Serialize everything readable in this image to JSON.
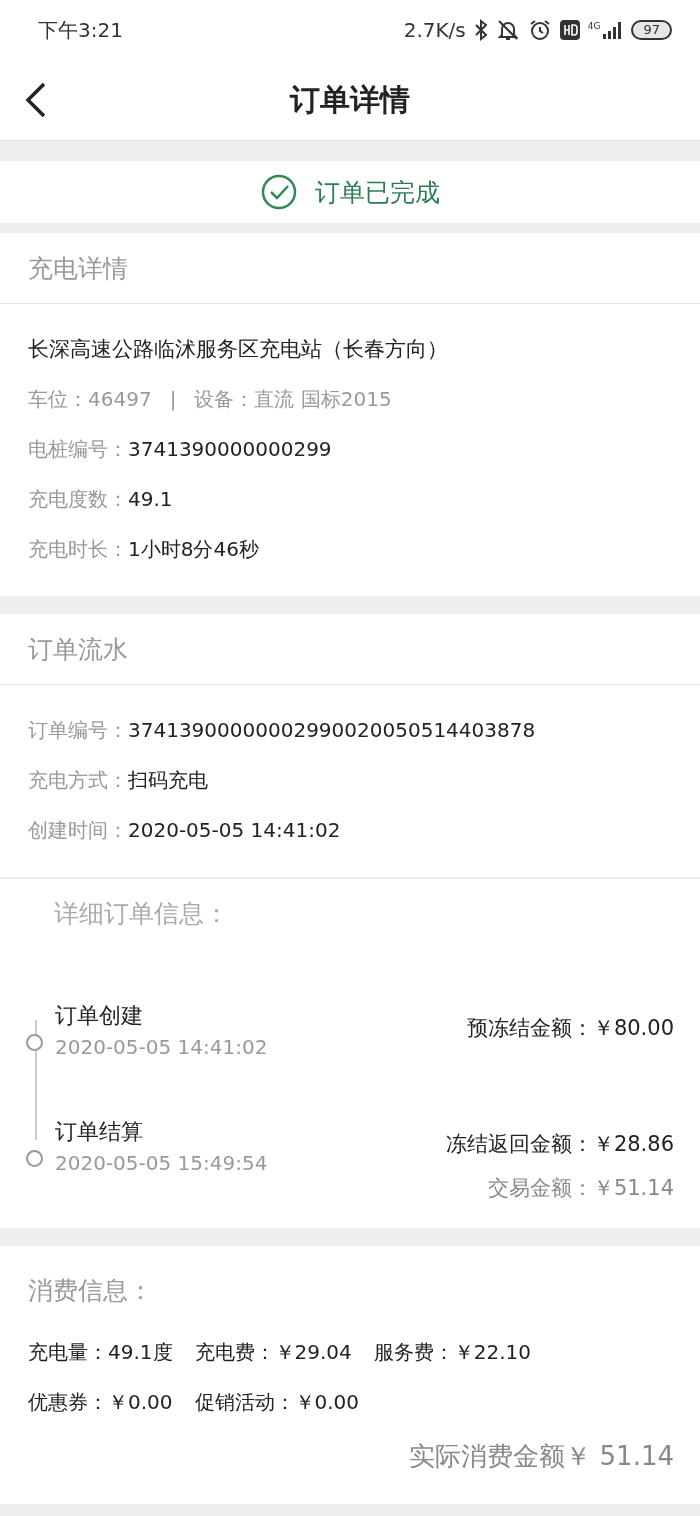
{
  "status_bar": {
    "time": "下午3:21",
    "speed": "2.7K/s",
    "network": "4G",
    "battery": "97"
  },
  "header": {
    "title": "订单详情"
  },
  "order_status": {
    "text": "订单已完成"
  },
  "charge_details": {
    "title": "充电详情",
    "station": "长深高速公路临沭服务区充电站（长春方向）",
    "meta": [
      "车位：46497",
      "|",
      "设备：直流 国标2015"
    ],
    "fields": [
      {
        "label": "电桩编号：",
        "value": "3741390000000299"
      },
      {
        "label": "充电度数：",
        "value": "49.1"
      },
      {
        "label": "充电时长：",
        "value": "1小时8分46秒"
      }
    ]
  },
  "order_flow": {
    "title": "订单流水",
    "fields": [
      {
        "label": "订单编号：",
        "value": "37413900000002990020050514403878"
      },
      {
        "label": "充电方式：",
        "value": "扫码充电"
      },
      {
        "label": "创建时间：",
        "value": "2020-05-05 14:41:02"
      }
    ]
  },
  "order_info": {
    "title": "详细订单信息：",
    "events": [
      {
        "title": "订单创建",
        "time": "2020-05-05 14:41:02",
        "amount": "预冻结金额：￥80.00"
      },
      {
        "title": "订单结算",
        "time": "2020-05-05 15:49:54",
        "amount": "冻结返回金额：￥28.86"
      }
    ],
    "total": "交易金额：￥51.14"
  },
  "consumption": {
    "title": "消费信息：",
    "lines": [
      [
        "充电量：49.1度",
        "充电费：￥29.04",
        "服务费：￥22.10"
      ],
      [
        "优惠券：￥0.00",
        "促销活动：￥0.00"
      ]
    ],
    "total": "实际消费金额￥ 51.14"
  }
}
